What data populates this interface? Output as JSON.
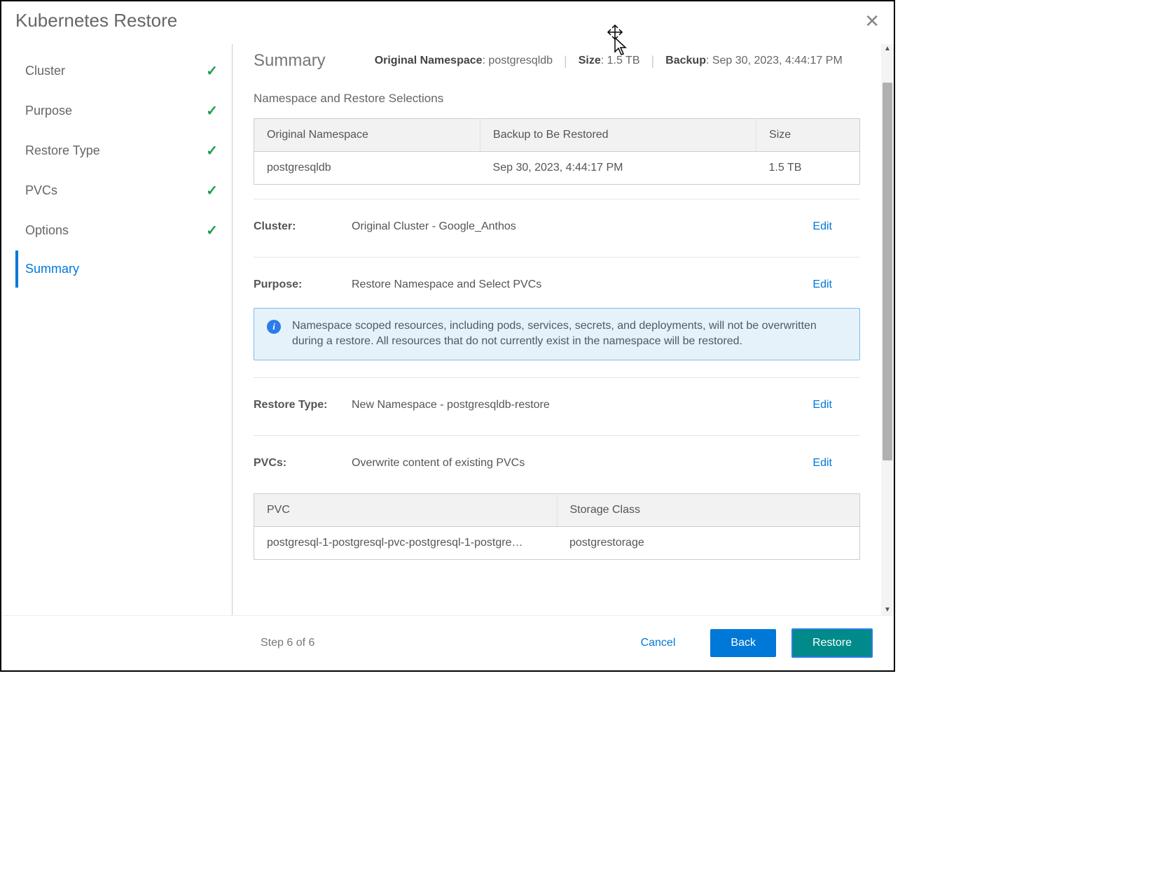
{
  "title": "Kubernetes Restore",
  "sidebar": {
    "items": [
      {
        "label": "Cluster",
        "checked": true,
        "active": false
      },
      {
        "label": "Purpose",
        "checked": true,
        "active": false
      },
      {
        "label": "Restore Type",
        "checked": true,
        "active": false
      },
      {
        "label": "PVCs",
        "checked": true,
        "active": false
      },
      {
        "label": "Options",
        "checked": true,
        "active": false
      },
      {
        "label": "Summary",
        "checked": false,
        "active": true
      }
    ]
  },
  "summary": {
    "heading": "Summary",
    "meta": {
      "original_namespace_label": "Original Namespace",
      "original_namespace_value": "postgresqldb",
      "size_label": "Size",
      "size_value": "1.5 TB",
      "backup_label": "Backup",
      "backup_value": "Sep 30, 2023, 4:44:17 PM"
    },
    "section_heading": "Namespace and Restore Selections",
    "ns_table": {
      "headers": [
        "Original Namespace",
        "Backup to Be Restored",
        "Size"
      ],
      "row": {
        "ns": "postgresqldb",
        "backup": "Sep 30, 2023, 4:44:17 PM",
        "size": "1.5 TB"
      }
    },
    "kv": {
      "cluster_label": "Cluster:",
      "cluster_value": "Original Cluster - Google_Anthos",
      "purpose_label": "Purpose:",
      "purpose_value": "Restore Namespace and Select PVCs",
      "restore_type_label": "Restore Type:",
      "restore_type_value": "New Namespace - postgresqldb-restore",
      "pvcs_label": "PVCs:",
      "pvcs_value": "Overwrite content of existing PVCs",
      "edit": "Edit"
    },
    "info_text": "Namespace scoped resources, including pods, services, secrets, and deployments, will not be overwritten during a restore. All resources that do not currently exist in the namespace will be restored.",
    "pvc_table": {
      "headers": [
        "PVC",
        "Storage Class"
      ],
      "row": {
        "pvc": "postgresql-1-postgresql-pvc-postgresql-1-postgresq…",
        "sc": "postgrestorage"
      }
    }
  },
  "footer": {
    "step": "Step 6 of 6",
    "cancel": "Cancel",
    "back": "Back",
    "restore": "Restore"
  }
}
